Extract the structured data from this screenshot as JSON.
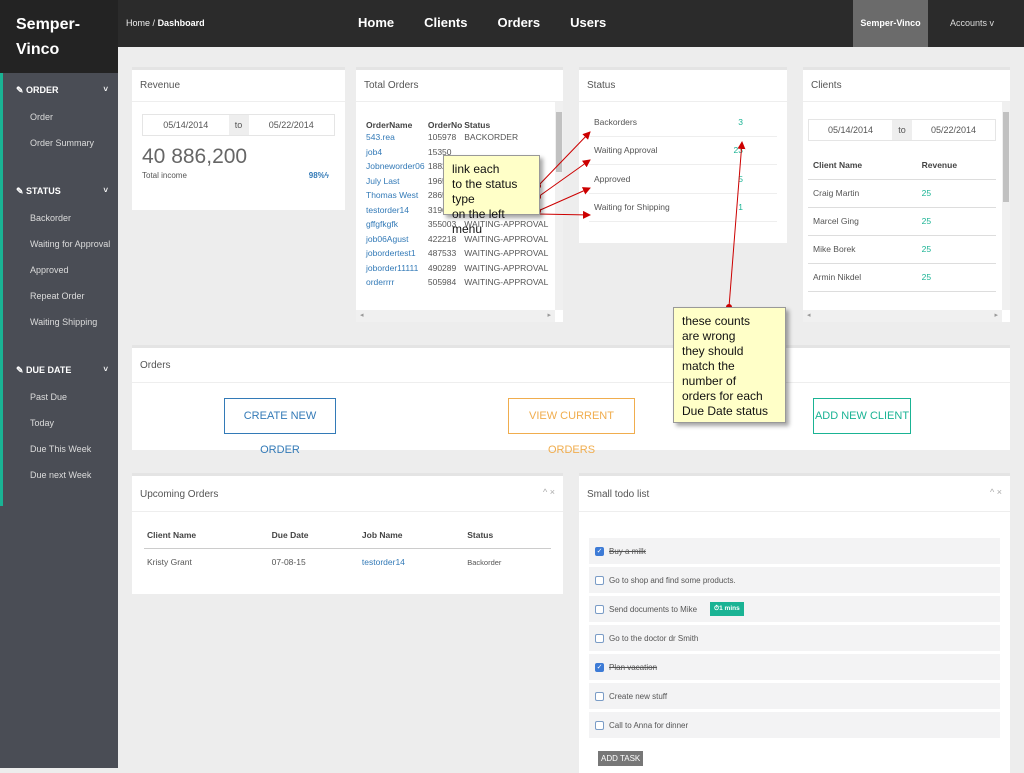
{
  "brand": "Semper-Vinco",
  "breadcrumb": {
    "home": "Home",
    "sep": "/",
    "current": "Dashboard"
  },
  "nav": [
    "Home",
    "Clients",
    "Orders",
    "Users"
  ],
  "brand_button": "Semper-Vinco",
  "accounts": "Accounts v",
  "sidebar": [
    {
      "title": "ORDER",
      "items": [
        "Order",
        "Order Summary"
      ]
    },
    {
      "title": "STATUS",
      "items": [
        "Backorder",
        "Waiting for Approval",
        "Approved",
        "Repeat Order",
        "Waiting Shipping"
      ]
    },
    {
      "title": "DUE DATE",
      "items": [
        "Past Due",
        "Today",
        "Due This Week",
        "Due next Week"
      ]
    }
  ],
  "revenue": {
    "title": "Revenue",
    "from": "05/14/2014",
    "to_label": "to",
    "to": "05/22/2014",
    "amount": "40 886,200",
    "label": "Total income",
    "percent": "98%"
  },
  "total_orders": {
    "title": "Total Orders",
    "columns": [
      "OrderName",
      "OrderNo",
      "Status"
    ],
    "rows": [
      [
        "543.rea",
        "105978",
        "BACKORDER"
      ],
      [
        "job4",
        "15350",
        ""
      ],
      [
        "Jobneworder06",
        "18822",
        ""
      ],
      [
        "July Last",
        "19655",
        ""
      ],
      [
        "Thomas West",
        "28653",
        ""
      ],
      [
        "testorder14",
        "319629",
        "BACKORDER"
      ],
      [
        "gffgfkgfk",
        "355003",
        "WAITING-APPROVAL"
      ],
      [
        "job06Agust",
        "422218",
        "WAITING-APPROVAL"
      ],
      [
        "jobordertest1",
        "487533",
        "WAITING-APPROVAL"
      ],
      [
        "joborder11111",
        "490289",
        "WAITING-APPROVAL"
      ],
      [
        "orderrrr",
        "505984",
        "WAITING-APPROVAL"
      ]
    ]
  },
  "status": {
    "title": "Status",
    "rows": [
      [
        "Backorders",
        "3"
      ],
      [
        "Waiting Approval",
        "23"
      ],
      [
        "Approved",
        "5"
      ],
      [
        "Waiting for Shipping",
        "1"
      ]
    ]
  },
  "clients": {
    "title": "Clients",
    "from": "05/14/2014",
    "to_label": "to",
    "to": "05/22/2014",
    "columns": [
      "Client Name",
      "Revenue"
    ],
    "rows": [
      [
        "Craig Martin",
        "25"
      ],
      [
        "Marcel Ging",
        "25"
      ],
      [
        "Mike Borek",
        "25"
      ],
      [
        "Armin Nikdel",
        "25"
      ]
    ]
  },
  "orders": {
    "title": "Orders",
    "create": "CREATE NEW ORDER",
    "view": "VIEW CURRENT ORDERS",
    "add_client": "ADD NEW CLIENT"
  },
  "upcoming": {
    "title": "Upcoming Orders",
    "columns": [
      "Client Name",
      "Due Date",
      "Job Name",
      "Status"
    ],
    "rows": [
      [
        "Kristy Grant",
        "07-08-15",
        "testorder14",
        "Backorder"
      ]
    ]
  },
  "todo": {
    "title": "Small todo list",
    "items": [
      {
        "text": "Buy a milk",
        "done": true
      },
      {
        "text": "Go to shop and find some products.",
        "done": false
      },
      {
        "text": "Send documents to Mike",
        "done": false,
        "badge": "⏱1 mins"
      },
      {
        "text": "Go to the doctor dr Smith",
        "done": false
      },
      {
        "text": "Plan vacation",
        "done": true
      },
      {
        "text": "Create new stuff",
        "done": false
      },
      {
        "text": "Call to Anna for dinner",
        "done": false
      }
    ],
    "add": "ADD TASK"
  },
  "notes": {
    "first": [
      "link each",
      "to the status type",
      "on the left menu"
    ],
    "second": [
      "these counts",
      "are wrong",
      "they should",
      "match the number of",
      "orders for each",
      "Due Date status"
    ]
  },
  "colors": {
    "accent": "#1ab394",
    "link": "#337ab7",
    "orange": "#f0ad4e",
    "annotation": "#ffffc8",
    "arrow": "#cc0000"
  }
}
